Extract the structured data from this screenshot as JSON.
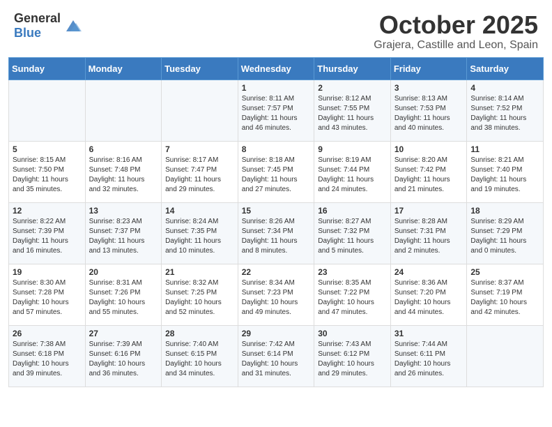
{
  "header": {
    "logo_general": "General",
    "logo_blue": "Blue",
    "month": "October 2025",
    "location": "Grajera, Castille and Leon, Spain"
  },
  "days_of_week": [
    "Sunday",
    "Monday",
    "Tuesday",
    "Wednesday",
    "Thursday",
    "Friday",
    "Saturday"
  ],
  "weeks": [
    [
      {
        "day": "",
        "info": ""
      },
      {
        "day": "",
        "info": ""
      },
      {
        "day": "",
        "info": ""
      },
      {
        "day": "1",
        "info": "Sunrise: 8:11 AM\nSunset: 7:57 PM\nDaylight: 11 hours and 46 minutes."
      },
      {
        "day": "2",
        "info": "Sunrise: 8:12 AM\nSunset: 7:55 PM\nDaylight: 11 hours and 43 minutes."
      },
      {
        "day": "3",
        "info": "Sunrise: 8:13 AM\nSunset: 7:53 PM\nDaylight: 11 hours and 40 minutes."
      },
      {
        "day": "4",
        "info": "Sunrise: 8:14 AM\nSunset: 7:52 PM\nDaylight: 11 hours and 38 minutes."
      }
    ],
    [
      {
        "day": "5",
        "info": "Sunrise: 8:15 AM\nSunset: 7:50 PM\nDaylight: 11 hours and 35 minutes."
      },
      {
        "day": "6",
        "info": "Sunrise: 8:16 AM\nSunset: 7:48 PM\nDaylight: 11 hours and 32 minutes."
      },
      {
        "day": "7",
        "info": "Sunrise: 8:17 AM\nSunset: 7:47 PM\nDaylight: 11 hours and 29 minutes."
      },
      {
        "day": "8",
        "info": "Sunrise: 8:18 AM\nSunset: 7:45 PM\nDaylight: 11 hours and 27 minutes."
      },
      {
        "day": "9",
        "info": "Sunrise: 8:19 AM\nSunset: 7:44 PM\nDaylight: 11 hours and 24 minutes."
      },
      {
        "day": "10",
        "info": "Sunrise: 8:20 AM\nSunset: 7:42 PM\nDaylight: 11 hours and 21 minutes."
      },
      {
        "day": "11",
        "info": "Sunrise: 8:21 AM\nSunset: 7:40 PM\nDaylight: 11 hours and 19 minutes."
      }
    ],
    [
      {
        "day": "12",
        "info": "Sunrise: 8:22 AM\nSunset: 7:39 PM\nDaylight: 11 hours and 16 minutes."
      },
      {
        "day": "13",
        "info": "Sunrise: 8:23 AM\nSunset: 7:37 PM\nDaylight: 11 hours and 13 minutes."
      },
      {
        "day": "14",
        "info": "Sunrise: 8:24 AM\nSunset: 7:35 PM\nDaylight: 11 hours and 10 minutes."
      },
      {
        "day": "15",
        "info": "Sunrise: 8:26 AM\nSunset: 7:34 PM\nDaylight: 11 hours and 8 minutes."
      },
      {
        "day": "16",
        "info": "Sunrise: 8:27 AM\nSunset: 7:32 PM\nDaylight: 11 hours and 5 minutes."
      },
      {
        "day": "17",
        "info": "Sunrise: 8:28 AM\nSunset: 7:31 PM\nDaylight: 11 hours and 2 minutes."
      },
      {
        "day": "18",
        "info": "Sunrise: 8:29 AM\nSunset: 7:29 PM\nDaylight: 11 hours and 0 minutes."
      }
    ],
    [
      {
        "day": "19",
        "info": "Sunrise: 8:30 AM\nSunset: 7:28 PM\nDaylight: 10 hours and 57 minutes."
      },
      {
        "day": "20",
        "info": "Sunrise: 8:31 AM\nSunset: 7:26 PM\nDaylight: 10 hours and 55 minutes."
      },
      {
        "day": "21",
        "info": "Sunrise: 8:32 AM\nSunset: 7:25 PM\nDaylight: 10 hours and 52 minutes."
      },
      {
        "day": "22",
        "info": "Sunrise: 8:34 AM\nSunset: 7:23 PM\nDaylight: 10 hours and 49 minutes."
      },
      {
        "day": "23",
        "info": "Sunrise: 8:35 AM\nSunset: 7:22 PM\nDaylight: 10 hours and 47 minutes."
      },
      {
        "day": "24",
        "info": "Sunrise: 8:36 AM\nSunset: 7:20 PM\nDaylight: 10 hours and 44 minutes."
      },
      {
        "day": "25",
        "info": "Sunrise: 8:37 AM\nSunset: 7:19 PM\nDaylight: 10 hours and 42 minutes."
      }
    ],
    [
      {
        "day": "26",
        "info": "Sunrise: 7:38 AM\nSunset: 6:18 PM\nDaylight: 10 hours and 39 minutes."
      },
      {
        "day": "27",
        "info": "Sunrise: 7:39 AM\nSunset: 6:16 PM\nDaylight: 10 hours and 36 minutes."
      },
      {
        "day": "28",
        "info": "Sunrise: 7:40 AM\nSunset: 6:15 PM\nDaylight: 10 hours and 34 minutes."
      },
      {
        "day": "29",
        "info": "Sunrise: 7:42 AM\nSunset: 6:14 PM\nDaylight: 10 hours and 31 minutes."
      },
      {
        "day": "30",
        "info": "Sunrise: 7:43 AM\nSunset: 6:12 PM\nDaylight: 10 hours and 29 minutes."
      },
      {
        "day": "31",
        "info": "Sunrise: 7:44 AM\nSunset: 6:11 PM\nDaylight: 10 hours and 26 minutes."
      },
      {
        "day": "",
        "info": ""
      }
    ]
  ]
}
